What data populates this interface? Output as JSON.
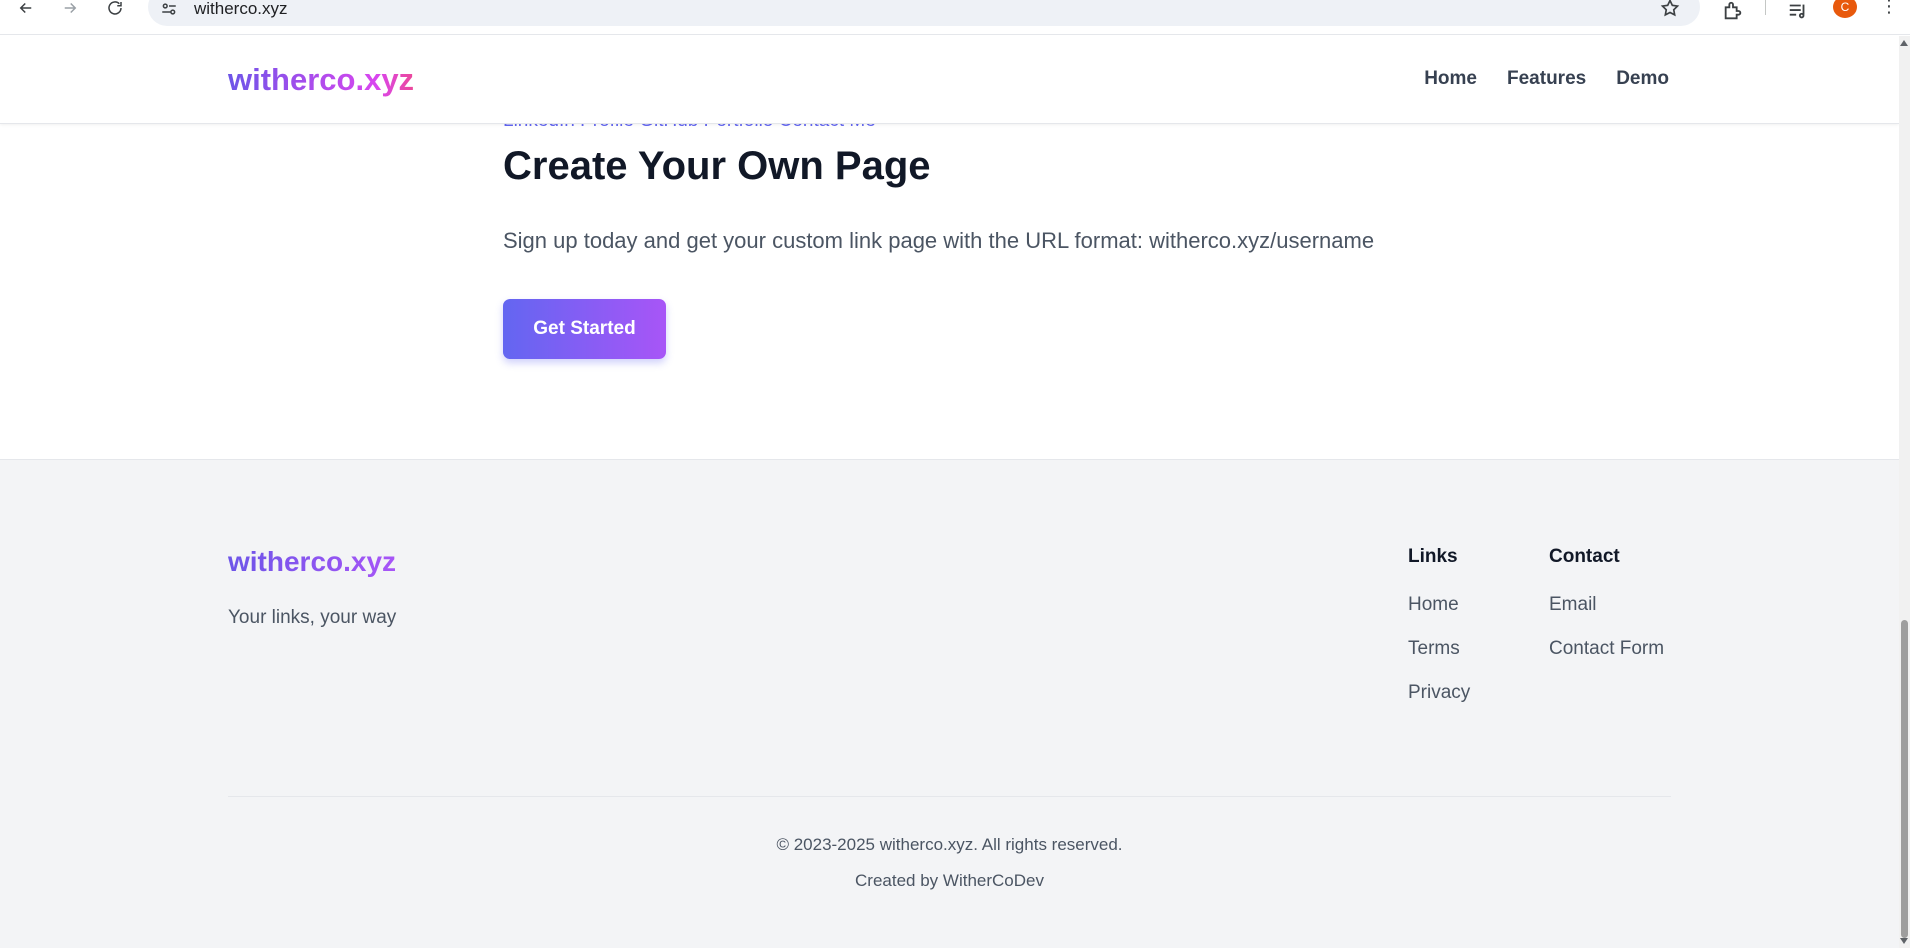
{
  "browser": {
    "url": "witherco.xyz",
    "avatar_letter": "C"
  },
  "header": {
    "logo": "witherco.xyz",
    "nav": [
      "Home",
      "Features",
      "Demo"
    ]
  },
  "cta": {
    "cut_links": "LinkedIn Profile GitHub Portfolio Contact Me",
    "title": "Create Your Own Page",
    "subtitle": "Sign up today and get your custom link page with the URL format: witherco.xyz/username",
    "button_label": "Get Started"
  },
  "footer": {
    "logo": "witherco.xyz",
    "tagline": "Your links, your way",
    "links_heading": "Links",
    "links": [
      "Home",
      "Terms",
      "Privacy"
    ],
    "contact_heading": "Contact",
    "contact": [
      "Email",
      "Contact Form"
    ],
    "copyright": "© 2023-2025 witherco.xyz. All rights reserved.",
    "credit": "Created by WitherCoDev"
  },
  "colors": {
    "accent_start": "#6366f1",
    "accent_end": "#a855f7",
    "footer_bg": "#f3f4f6",
    "heading": "#111827",
    "body_text": "#4b5563"
  }
}
